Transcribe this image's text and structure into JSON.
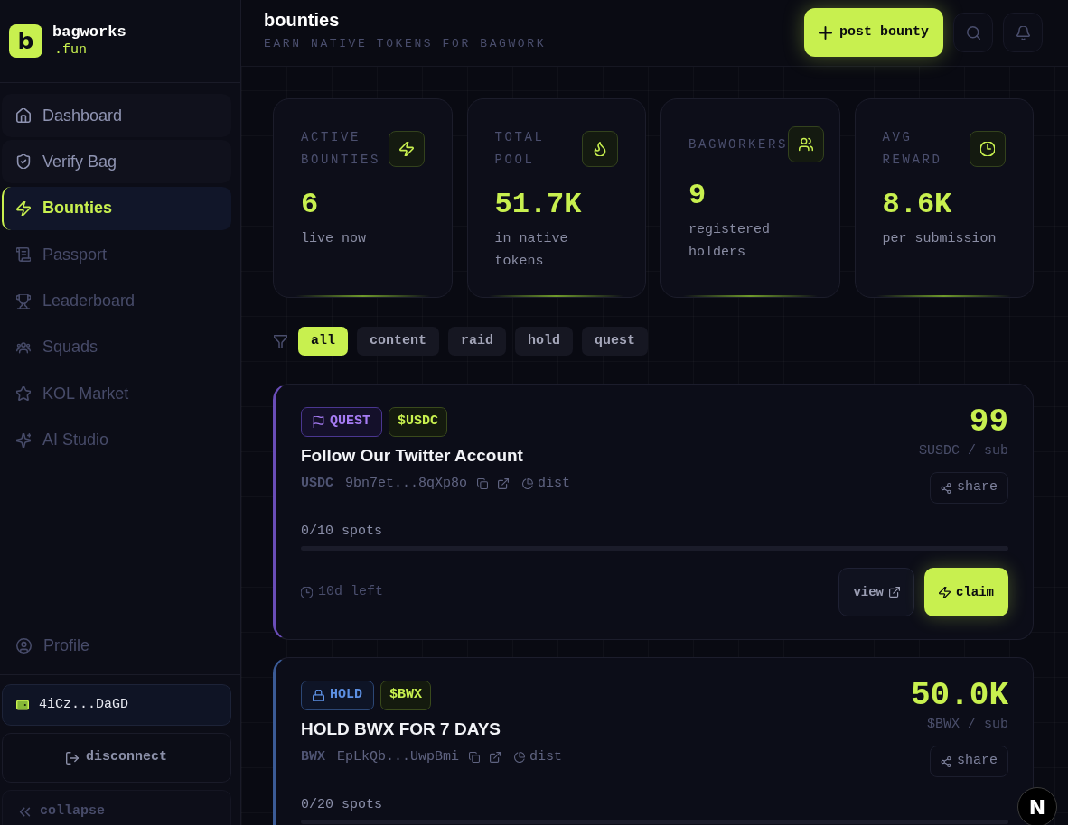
{
  "sidebar": {
    "logo": {
      "mark": "b",
      "name": "bagworks",
      "suffix": ".fun"
    },
    "nav": [
      {
        "label": "Dashboard",
        "selected": false,
        "highlighted": true
      },
      {
        "label": "Verify Bag",
        "selected": false,
        "highlighted": true
      },
      {
        "label": "Bounties",
        "selected": true,
        "highlighted": false
      },
      {
        "label": "Passport",
        "selected": false,
        "highlighted": false
      },
      {
        "label": "Leaderboard",
        "selected": false,
        "highlighted": false
      },
      {
        "label": "Squads",
        "selected": false,
        "highlighted": false
      },
      {
        "label": "KOL Market",
        "selected": false,
        "highlighted": false
      },
      {
        "label": "AI Studio",
        "selected": false,
        "highlighted": false
      }
    ],
    "profile": {
      "label": "Profile"
    },
    "wallet": {
      "address": "4iCz...DaGD"
    },
    "disconnect": "disconnect",
    "collapse": "collapse"
  },
  "header": {
    "title": "bounties",
    "subtitle": "EARN NATIVE TOKENS FOR BAGWORK",
    "post_button": "post bounty"
  },
  "stats": [
    {
      "label": "ACTIVE BOUNTIES",
      "value": "6",
      "caption": "live now"
    },
    {
      "label": "TOTAL POOL",
      "value": "51.7K",
      "caption": "in native tokens"
    },
    {
      "label": "BAGWORKERS",
      "value": "9",
      "caption": "registered holders"
    },
    {
      "label": "AVG REWARD",
      "value": "8.6K",
      "caption": "per submission"
    }
  ],
  "filters": [
    {
      "label": "all",
      "selected": true
    },
    {
      "label": "content",
      "selected": false
    },
    {
      "label": "raid",
      "selected": false
    },
    {
      "label": "hold",
      "selected": false
    },
    {
      "label": "quest",
      "selected": false
    }
  ],
  "bounties": [
    {
      "kind": "quest",
      "type_label": "QUEST",
      "token_tag": "$USDC",
      "title": "Follow Our Twitter Account",
      "token": "USDC",
      "address": "9bn7et...8qXp8o",
      "dist_label": "dist",
      "reward": "99",
      "reward_unit": "$USDC / sub",
      "share_label": "share",
      "spots": "0/10 spots",
      "level": 0,
      "time_left": "10d left",
      "view_label": "view",
      "claim_label": "claim"
    },
    {
      "kind": "hold",
      "type_label": "HOLD",
      "token_tag": "$BWX",
      "title": "HOLD BWX FOR 7 DAYS",
      "token": "BWX",
      "address": "EpLkQb...UwpBmi",
      "dist_label": "dist",
      "reward": "50.0K",
      "reward_unit": "$BWX / sub",
      "share_label": "share",
      "spots": "0/20 spots",
      "level": 0
    }
  ],
  "dev_badge": {
    "label": "N"
  }
}
